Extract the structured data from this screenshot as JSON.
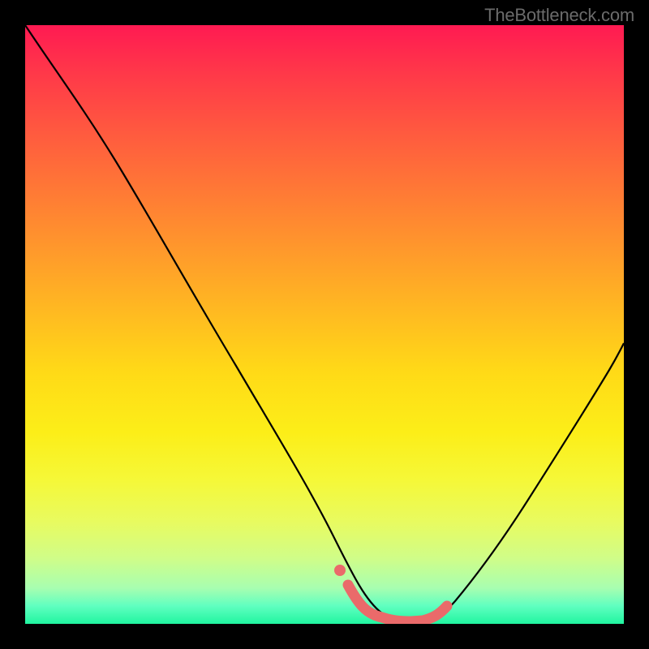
{
  "watermark": "TheBottleneck.com",
  "chart_data": {
    "type": "line",
    "title": "",
    "xlabel": "",
    "ylabel": "",
    "xlim": [
      0,
      100
    ],
    "ylim": [
      0,
      100
    ],
    "background_gradient": {
      "top": "#ff1a52",
      "bottom": "#20f5a0",
      "stops": [
        {
          "pos": 0.0,
          "color": "#ff1a52"
        },
        {
          "pos": 0.5,
          "color": "#ffd020"
        },
        {
          "pos": 0.9,
          "color": "#d0fd88"
        },
        {
          "pos": 1.0,
          "color": "#20f5a0"
        }
      ]
    },
    "series": [
      {
        "name": "bottleneck-curve",
        "color": "#000000",
        "x": [
          0,
          5,
          10,
          15,
          20,
          25,
          30,
          35,
          40,
          45,
          50,
          52,
          54,
          56,
          58,
          60,
          62,
          64,
          66,
          68,
          70,
          75,
          80,
          85,
          90,
          95,
          100
        ],
        "values": [
          100,
          93,
          85,
          77,
          69,
          61,
          52,
          44,
          35,
          26,
          17,
          13,
          8,
          4,
          2,
          1,
          1,
          1,
          2,
          3,
          5,
          13,
          23,
          33,
          43,
          52,
          60
        ]
      },
      {
        "name": "highlight-segment",
        "color": "#ea6a6a",
        "x": [
          54,
          56,
          58,
          60,
          62,
          64,
          66,
          68
        ],
        "values": [
          4,
          2.5,
          1.5,
          1,
          1,
          1.2,
          2,
          3
        ]
      },
      {
        "name": "highlight-dot",
        "color": "#ea6a6a",
        "x": [
          52
        ],
        "values": [
          7
        ]
      }
    ]
  }
}
